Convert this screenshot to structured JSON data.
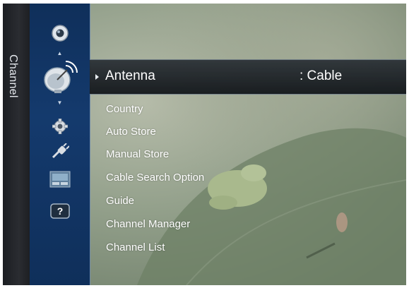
{
  "window": {
    "title": "Channel"
  },
  "icons": [
    {
      "name": "picture-icon"
    },
    {
      "name": "channel-antenna-icon"
    },
    {
      "name": "setup-gear-icon"
    },
    {
      "name": "input-plug-icon"
    },
    {
      "name": "application-icon"
    },
    {
      "name": "support-help-icon"
    }
  ],
  "selected": {
    "label": "Antenna",
    "value": ": Cable"
  },
  "menu": [
    "Country",
    "Auto Store",
    "Manual Store",
    "Cable Search Option",
    "Guide",
    "Channel Manager",
    "Channel List"
  ],
  "help_symbol": "?",
  "colors": {
    "icon_column": "#143a6d",
    "title_strip": "#2a2c31",
    "selection": "#1c2126"
  }
}
